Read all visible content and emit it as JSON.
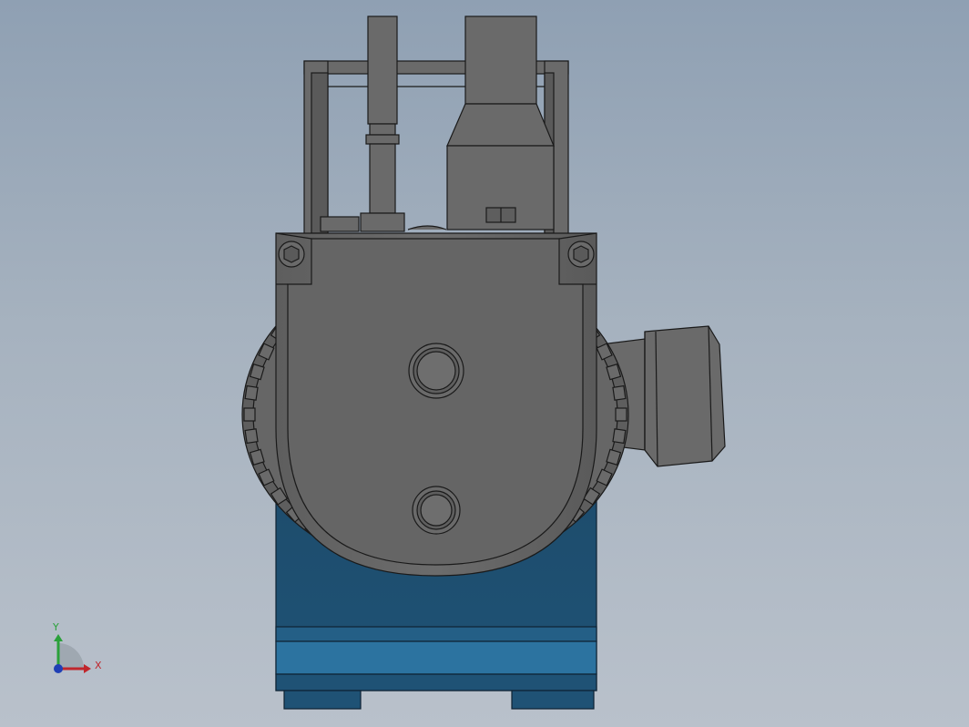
{
  "viewport": {
    "background_top": "#8fa0b3",
    "background_bottom": "#b9c1cb"
  },
  "model": {
    "description_icon": "vacuum-pump-3d-model",
    "colors": {
      "body_grey": "#6a6a6a",
      "body_grey_dark": "#4f4f4f",
      "base_blue": "#1f4e6e",
      "base_blue_light": "#2a6f97",
      "edge": "#1a1a1a"
    }
  },
  "triad": {
    "x_label": "X",
    "y_label": "Y",
    "x_color": "#c0262c",
    "y_color": "#2aa13a",
    "z_color": "#1f3fb5"
  }
}
